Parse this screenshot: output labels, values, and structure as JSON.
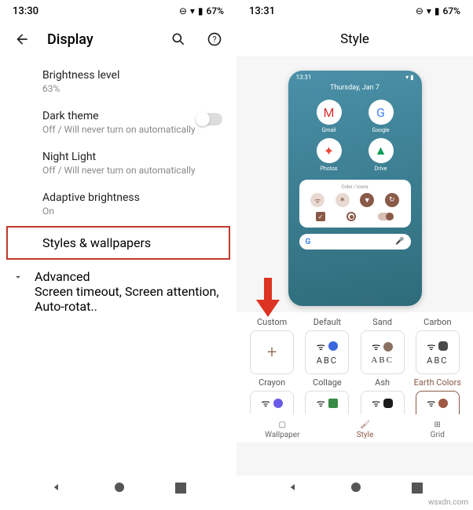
{
  "left": {
    "status": {
      "time": "13:30",
      "battery": "67%"
    },
    "title": "Display",
    "items": {
      "brightness": {
        "title": "Brightness level",
        "sub": "63%"
      },
      "dark": {
        "title": "Dark theme",
        "sub": "Off / Will never turn on automatically"
      },
      "night": {
        "title": "Night Light",
        "sub": "Off / Will never turn on automatically"
      },
      "adaptive": {
        "title": "Adaptive brightness",
        "sub": "On"
      },
      "styles": {
        "title": "Styles & wallpapers"
      },
      "advanced": {
        "title": "Advanced",
        "sub": "Screen timeout, Screen attention, Auto-rotat.."
      }
    }
  },
  "right": {
    "status": {
      "time": "13:31",
      "battery": "67%"
    },
    "title": "Style",
    "preview": {
      "time": "13:31",
      "date": "Thursday, Jan 7",
      "apps": [
        {
          "name": "Gmail",
          "glyph": "M"
        },
        {
          "name": "Google",
          "glyph": "G"
        },
        {
          "name": "Photos",
          "glyph": "✦"
        },
        {
          "name": "Drive",
          "glyph": "▲"
        }
      ],
      "card_caption": "Color / Icons"
    },
    "styles_row1": [
      {
        "label": "Custom",
        "type": "plus"
      },
      {
        "label": "Default",
        "color": "#3a66e0",
        "abc": "ABC"
      },
      {
        "label": "Sand",
        "color": "#8a7060",
        "abc": "ABC",
        "serif": true
      },
      {
        "label": "Carbon",
        "color": "#4a4a4a",
        "abc": "ABC"
      }
    ],
    "styles_row2": [
      {
        "label": "Crayon",
        "color": "#6a5ae8"
      },
      {
        "label": "Collage",
        "color": "#3a8a48"
      },
      {
        "label": "Ash",
        "color": "#1a1a1a"
      },
      {
        "label": "Earth Colors",
        "color": "#a05a44",
        "selected": true
      }
    ],
    "tabs": {
      "wallpaper": "Wallpaper",
      "style": "Style",
      "grid": "Grid"
    }
  },
  "watermark": "wsxdn.com"
}
